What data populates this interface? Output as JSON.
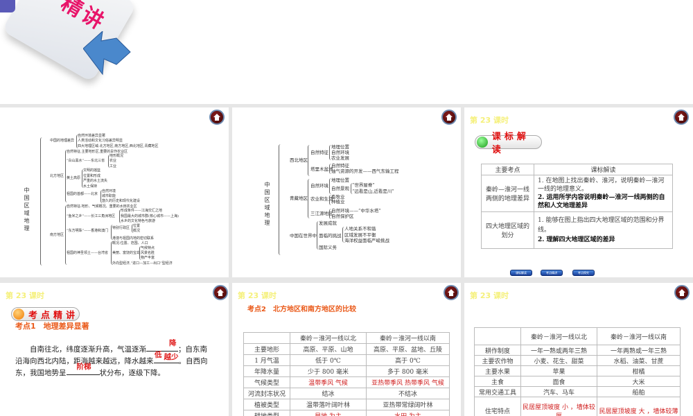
{
  "top": {
    "graphic_text": "精讲"
  },
  "lesson": "第 23 课时",
  "mindmap1": {
    "root": "中国区域地理",
    "n1": "中国的地理差异",
    "n1c": [
      "自然环境差异显著",
      "人类活动和文化习俗差异明显",
      "四大地理区域:北方地区,南方地区,西北地区,青藏地区"
    ],
    "n2": "北方地区",
    "n2a": "自然特征,主要地形区,重要的旱作农业区",
    "n2b": "“白山黑水”——东北三省",
    "n2bc": [
      "地形概况",
      "农业",
      "工业"
    ],
    "n2c": "黄土高原",
    "n2cc": [
      "文明的摇篮",
      "位置和形成",
      "严重的水土流失",
      "水土保持"
    ],
    "n2d": "祖国的首都——北京",
    "n2dc": [
      "自然环境",
      "城市职能",
      "悠久的历史和现代化建设"
    ],
    "n3": "南方地区",
    "n3a": "自然特征:地形、气候概况、重要的水田农业区",
    "n3b": "“鱼米之乡”——长江三角洲地区",
    "n3bc": [
      "形成条件——江海交汇之地",
      "我国最大的城市群(核心城市——上海)",
      "水乡的文化特色与旅游"
    ],
    "n3c": "“东方明珠”——香港和澳门",
    "n3c1": "特别行政区",
    "n3c1c": [
      "位置",
      "概况"
    ],
    "n3c2": "港澳与祖国内地的密切联系",
    "n3d": "祖国的神圣领土——台湾省",
    "n3d1": "概况:位置、范围、人口",
    "n3d2": "美丽、富饶的宝岛",
    "n3d2c": [
      "气候特点",
      "风景名胜",
      "物产丰富"
    ],
    "n3d3": "外向型经济,“进口—加工—出口”型经济"
  },
  "mindmap2": {
    "root": "中国区域地理",
    "a": "西北地区",
    "a1": "自然特征",
    "a1c": [
      "地理位置",
      "自然环境",
      "农业发展"
    ],
    "a2": "塔里木盆地",
    "a2c": [
      "自然特征",
      "油气资源的开发——西气东输工程"
    ],
    "b": "青藏地区",
    "b1": "自然环境",
    "b1a": "地理位置",
    "b1b": "自然景观",
    "b1bc": [
      "“世界屋脊”",
      "“远看是山,近看是川”"
    ],
    "b2": "农业和生活",
    "b2c": [
      "畜牧业",
      "种植业"
    ],
    "b3": "三江源地区",
    "b3c": [
      "自然环境——“中华水塔”",
      "自然保护区"
    ],
    "c": "中国在世界中",
    "c1": "发展成就",
    "c2": "面临的挑战",
    "c2c": [
      "人地关系不和谐",
      "区域发展不平衡",
      "海洋权益面临严峻挑战"
    ],
    "c3": "国际义务"
  },
  "standards": {
    "pill": "课标解读",
    "headers": [
      "主要考点",
      "课标解读"
    ],
    "r1": {
      "topic": "秦岭—淮河一线两侧的地理差异",
      "p1": "1. 在地图上找出秦岭、淮河，说明秦岭—淮河一线的地理意义。",
      "p2": "2. 运用所学内容说明秦岭—淮河一线两侧的自然和人文地理差异"
    },
    "r2": {
      "topic": "四大地理区域的划分",
      "p1": "1. 能够在图上指出四大地理区域的范围和分界线。",
      "p2": "2. 理解四大地理区域的差异"
    },
    "nav": [
      "课标解读",
      "考点精讲",
      "考点探究"
    ]
  },
  "point1": {
    "pill": "考点精讲",
    "title": "考点1　地理差异显著",
    "t1": "自南往北，纬度逐渐升高，气温逐渐",
    "a1": "降低",
    "t2": "；自东南沿海向西北内陆，距海越来越远，降水越来",
    "a2": "越少",
    "t3": "。自西向东，我国地势呈",
    "a3": "阶梯",
    "t4": "状分布，逐级下降。"
  },
  "point2": {
    "title": "考点2　北方地区和南方地区的比较",
    "headers": [
      "",
      "秦岭－淮河一线以北",
      "秦岭－淮河一线以南"
    ],
    "rows": [
      [
        "主要地形",
        "高原、平原、山地",
        "高原、平原、盆地、丘陵"
      ],
      [
        "1 月气温",
        "低于 0℃",
        "高于 0℃"
      ],
      [
        "年降水量",
        "少于 800 毫米",
        "多于 800 毫米"
      ],
      [
        "气候类型",
        "温带季风 气候",
        "亚热带季风 热带季风 气候"
      ],
      [
        "河流封冻状况",
        "结冰",
        "不结冰"
      ],
      [
        "植被类型",
        "温带落叶阔叶林",
        "亚热带常绿阔叶林"
      ],
      [
        "耕地类型",
        "旱地 为主",
        "水田 为主"
      ]
    ]
  },
  "compare2": {
    "headers": [
      "",
      "秦岭－淮河一线以北",
      "秦岭－淮河一线以南"
    ],
    "rows": [
      [
        "耕作制度",
        "一年一熟或两年三熟",
        "一年两熟或一年三熟"
      ],
      [
        "主要农作物",
        "小麦、花生、甜菜",
        "水稻、油菜、甘蔗"
      ],
      [
        "主要水果",
        "苹果",
        "柑橘"
      ],
      [
        "主食",
        "面食",
        "大米"
      ],
      [
        "常用交通工具",
        "汽车、马车",
        "船舶"
      ],
      [
        "住宅特点",
        "民居屋顶坡度 小 ，墙体较厚",
        "民居屋顶坡度 大 ，墙体较薄"
      ]
    ]
  }
}
